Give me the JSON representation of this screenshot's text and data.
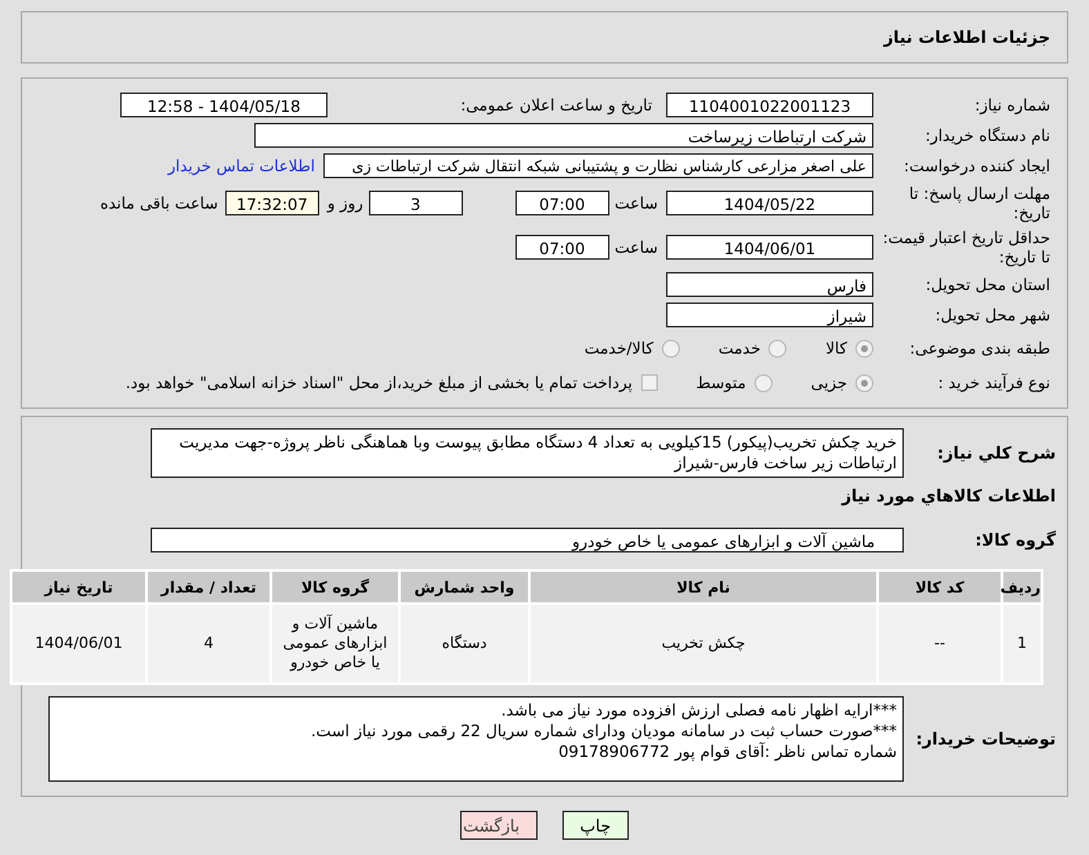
{
  "title": "جزئیات اطلاعات نیاز",
  "need_number": {
    "label": "شماره نیاز:",
    "value": "1104001022001123"
  },
  "announce": {
    "label": "تاریخ و ساعت اعلان عمومی:",
    "value": "1404/05/18 - 12:58"
  },
  "buyer": {
    "label": "نام دستگاه خریدار:",
    "value": "شرکت ارتباطات زیرساخت"
  },
  "creator": {
    "label": "ایجاد کننده درخواست:",
    "value": "علی اصغر مزارعی کارشناس نظارت و پشتیبانی شبکه انتقال شرکت ارتباطات زی",
    "link": "اطلاعات تماس خریدار"
  },
  "deadline": {
    "label": "مهلت ارسال پاسخ: تا تاریخ:",
    "date": "1404/05/22",
    "time_label": "ساعت",
    "time": "07:00",
    "days": "3",
    "days_label": "روز و",
    "remaining": "17:32:07",
    "remaining_label": "ساعت باقی مانده"
  },
  "validity": {
    "label": "حداقل تاریخ اعتبار قیمت: تا تاریخ:",
    "date": "1404/06/01",
    "time_label": "ساعت",
    "time": "07:00"
  },
  "province": {
    "label": "استان محل تحویل:",
    "value": "فارس"
  },
  "city": {
    "label": "شهر محل تحویل:",
    "value": "شیراز"
  },
  "category": {
    "label": "طبقه بندی موضوعی:",
    "options": [
      {
        "label": "کالا",
        "selected": true
      },
      {
        "label": "خدمت",
        "selected": false
      },
      {
        "label": "کالا/خدمت",
        "selected": false
      }
    ]
  },
  "process": {
    "label": "نوع فرآیند خرید :",
    "options": [
      {
        "label": "جزیی",
        "selected": true
      },
      {
        "label": "متوسط",
        "selected": false
      }
    ],
    "treasury": {
      "label": "پرداخت تمام یا بخشی از مبلغ خرید،از محل \"اسناد خزانه اسلامی\" خواهد بود.",
      "checked": false
    }
  },
  "description": {
    "label": "شرح كلي نياز:",
    "text": "خرید چکش تخریب(پیکور) 15کیلویی به تعداد 4 دستگاه مطابق پیوست وبا هماهنگی ناظر پروژه-جهت مدیریت ارتباطات زیر ساخت فارس-شیراز"
  },
  "goods_heading": "اطلاعات كالاهاي مورد نياز",
  "goods_group": {
    "label": "گروه کالا:",
    "value": "ماشین آلات و ابزارهای عمومی یا خاص خودرو"
  },
  "table": {
    "columns": [
      "ردیف",
      "کد کالا",
      "نام کالا",
      "واحد شمارش",
      "گروه کالا",
      "تعداد / مقدار",
      "تاریخ نیاز"
    ],
    "rows": [
      [
        "1",
        "--",
        "چکش تخریب",
        "دستگاه",
        "ماشین آلات و ابزارهای عمومی یا خاص خودرو",
        "4",
        "1404/06/01"
      ]
    ]
  },
  "buyer_notes": {
    "label": "توضیحات خریدار:",
    "lines": [
      "***ارایه اظهار نامه فصلی ارزش افزوده مورد نیاز می باشد.",
      "***صورت حساب ثبت در سامانه مودیان ودارای شماره سریال 22 رقمی مورد نیاز است.",
      "شماره تماس ناظر :آقای قوام پور 09178906772"
    ]
  },
  "buttons": [
    {
      "label": "چاپ",
      "kind": "print"
    },
    {
      "label": "بازگشت",
      "kind": "back"
    }
  ]
}
